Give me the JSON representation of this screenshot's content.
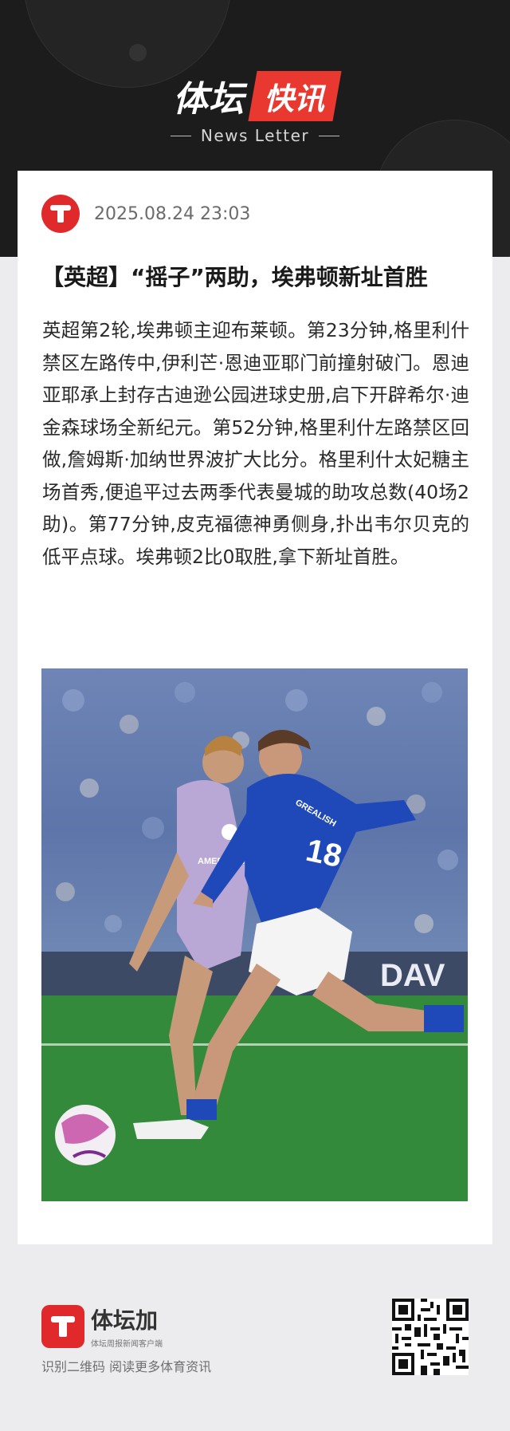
{
  "header": {
    "brand_name": "体坛",
    "brand_tag": "快讯",
    "subtitle": "News Letter"
  },
  "article": {
    "datetime": "2025.08.24 23:03",
    "title": "【英超】“摇子”两助，埃弗顿新址首胜",
    "body": "英超第2轮,埃弗顿主迎布莱顿。第23分钟,格里利什禁区左路传中,伊利芒·恩迪亚耶门前撞射破门。恩迪亚耶承上封存古迪逊公园进球史册,启下开辟希尔·迪金森球场全新纪元。第52分钟,格里利什左路禁区回做,詹姆斯·加纳世界波扩大比分。格里利什太妃糖主场首秀,便追平过去两季代表曼城的助攻总数(40场2助)。第77分钟,皮克福德神勇侧身,扑出韦尔贝克的低平点球。埃弗顿2比0取胜,拿下新址首胜。",
    "photo": {
      "jersey_number": "18",
      "jersey_name": "GREALISH",
      "sponsor_text": "AMERICAN EXPRESS",
      "board_text": "DAV"
    }
  },
  "footer": {
    "app_name": "体坛加",
    "app_sub": "体坛周报新闻客户端",
    "note": "识别二维码 阅读更多体育资讯"
  },
  "colors": {
    "brand_red": "#e0292a",
    "header_bg": "#1c1c1c",
    "page_bg": "#ececef"
  }
}
